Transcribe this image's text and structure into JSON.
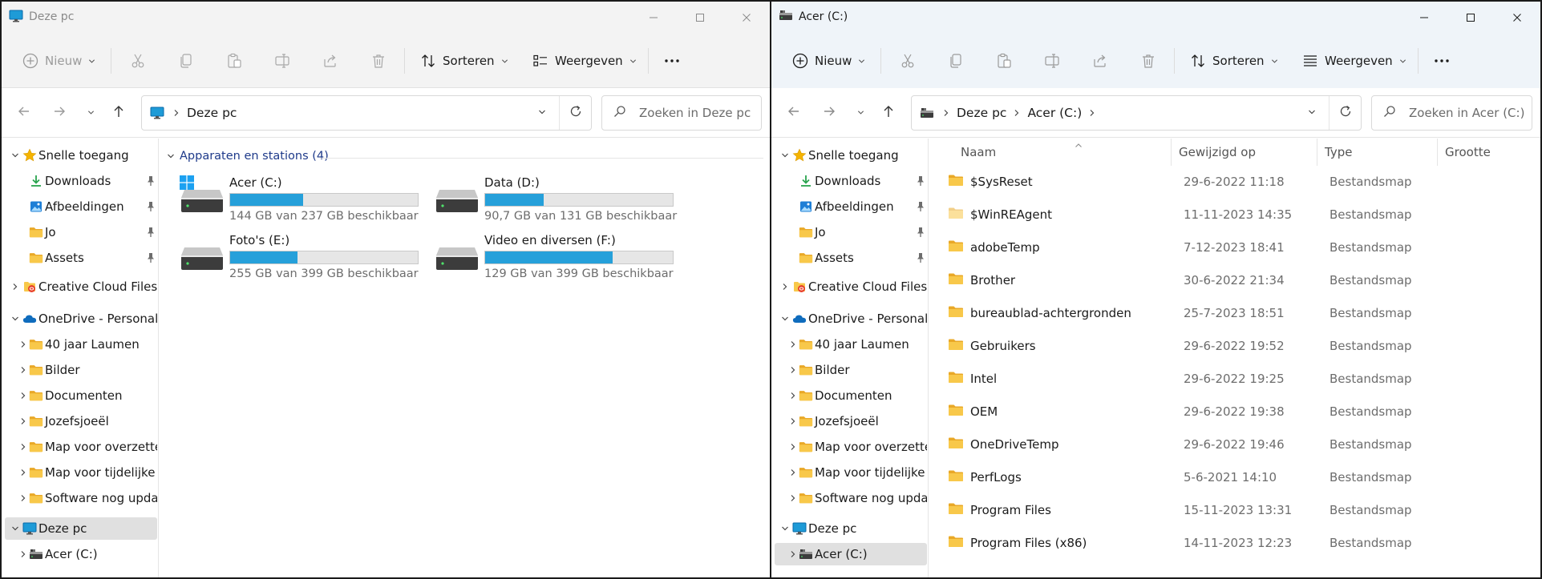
{
  "left": {
    "title": "Deze pc",
    "toolbar": {
      "new": "Nieuw",
      "sort": "Sorteren",
      "view": "Weergeven"
    },
    "breadcrumbs": [
      "Deze pc"
    ],
    "search_placeholder": "Zoeken in Deze pc",
    "nav": {
      "quick_access": "Snelle toegang",
      "pinned": [
        "Downloads",
        "Afbeeldingen",
        "Jo",
        "Assets"
      ],
      "creative_cloud": "Creative Cloud Files",
      "onedrive": "OneDrive - Personal",
      "onedrive_items": [
        "40 jaar Laumen",
        "Bilder",
        "Documenten",
        "Jozefsjoeël",
        "Map voor overzette",
        "Map voor tijdelijke",
        "Software nog upda"
      ],
      "this_pc": "Deze pc",
      "this_pc_child": "Acer (C:)"
    },
    "group_header": "Apparaten en stations (4)",
    "drives": [
      {
        "name": "Acer (C:)",
        "info": "144 GB van 237 GB beschikbaar",
        "used_fraction": 0.39,
        "type": "windows"
      },
      {
        "name": "Data (D:)",
        "info": "90,7 GB van 131 GB beschikbaar",
        "used_fraction": 0.31,
        "type": "disk"
      },
      {
        "name": "Foto's (E:)",
        "info": "255 GB van 399 GB beschikbaar",
        "used_fraction": 0.36,
        "type": "disk"
      },
      {
        "name": "Video en diversen (F:)",
        "info": "129 GB van 399 GB beschikbaar",
        "used_fraction": 0.68,
        "type": "disk"
      }
    ]
  },
  "right": {
    "title": "Acer (C:)",
    "toolbar": {
      "new": "Nieuw",
      "sort": "Sorteren",
      "view": "Weergeven"
    },
    "breadcrumbs": [
      "Deze pc",
      "Acer (C:)"
    ],
    "search_placeholder": "Zoeken in Acer (C:)",
    "nav": {
      "quick_access": "Snelle toegang",
      "pinned": [
        "Downloads",
        "Afbeeldingen",
        "Jo",
        "Assets"
      ],
      "creative_cloud": "Creative Cloud Files",
      "onedrive": "OneDrive - Personal",
      "onedrive_items": [
        "40 jaar Laumen",
        "Bilder",
        "Documenten",
        "Jozefsjoeël",
        "Map voor overzette",
        "Map voor tijdelijke",
        "Software nog upda"
      ],
      "this_pc": "Deze pc",
      "this_pc_child": "Acer (C:)"
    },
    "columns": {
      "name": "Naam",
      "modified": "Gewijzigd op",
      "type": "Type",
      "size": "Grootte"
    },
    "files": [
      {
        "name": "$SysReset",
        "modified": "29-6-2022 11:18",
        "type": "Bestandsmap",
        "dim": false
      },
      {
        "name": "$WinREAgent",
        "modified": "11-11-2023 14:35",
        "type": "Bestandsmap",
        "dim": true
      },
      {
        "name": "adobeTemp",
        "modified": "7-12-2023 18:41",
        "type": "Bestandsmap",
        "dim": false
      },
      {
        "name": "Brother",
        "modified": "30-6-2022 21:34",
        "type": "Bestandsmap",
        "dim": false
      },
      {
        "name": "bureaublad-achtergronden",
        "modified": "25-7-2023 18:51",
        "type": "Bestandsmap",
        "dim": false
      },
      {
        "name": "Gebruikers",
        "modified": "29-6-2022 19:52",
        "type": "Bestandsmap",
        "dim": false
      },
      {
        "name": "Intel",
        "modified": "29-6-2022 19:25",
        "type": "Bestandsmap",
        "dim": false
      },
      {
        "name": "OEM",
        "modified": "29-6-2022 19:38",
        "type": "Bestandsmap",
        "dim": false
      },
      {
        "name": "OneDriveTemp",
        "modified": "29-6-2022 19:46",
        "type": "Bestandsmap",
        "dim": false
      },
      {
        "name": "PerfLogs",
        "modified": "5-6-2021 14:10",
        "type": "Bestandsmap",
        "dim": false
      },
      {
        "name": "Program Files",
        "modified": "15-11-2023 13:31",
        "type": "Bestandsmap",
        "dim": false
      },
      {
        "name": "Program Files (x86)",
        "modified": "14-11-2023 12:23",
        "type": "Bestandsmap",
        "dim": false
      }
    ]
  },
  "colors": {
    "accent": "#0067c0",
    "bar_fill": "#26a0da",
    "folder": "#f8c84a",
    "star": "#f5b400",
    "onedrive": "#0f6cbd",
    "group_header": "#1e3a8a"
  },
  "icons": [
    "monitor-icon",
    "drive-icon",
    "folder-icon",
    "star-icon",
    "download-icon",
    "image-icon",
    "pin-icon",
    "cloud-icon",
    "creative-cloud-icon",
    "windows-logo-icon",
    "search-icon",
    "refresh-icon",
    "cut-icon",
    "copy-icon",
    "paste-icon",
    "rename-icon",
    "share-icon",
    "delete-icon",
    "sort-icon",
    "view-icon",
    "more-icon",
    "plus-icon"
  ]
}
